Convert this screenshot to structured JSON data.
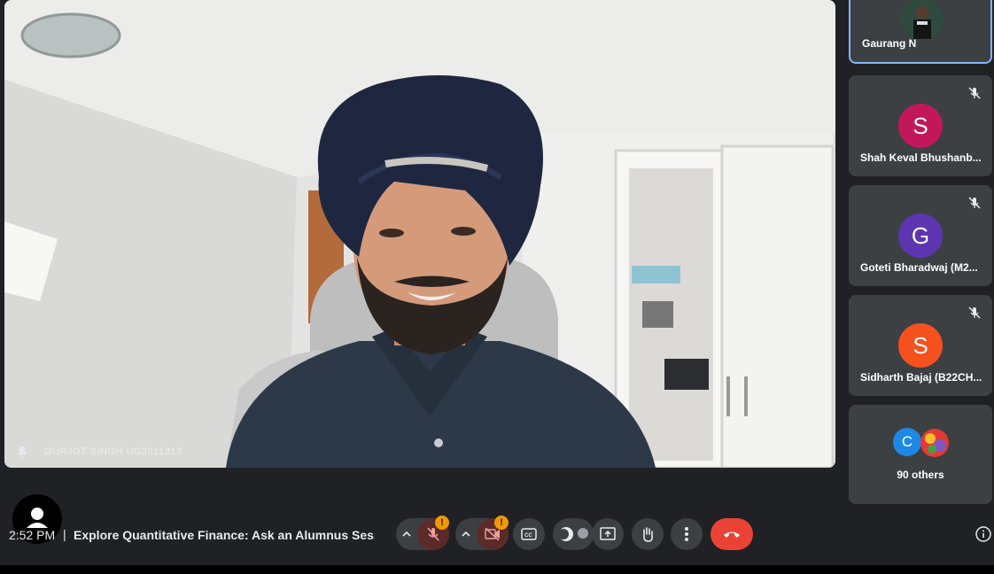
{
  "main_speaker": {
    "name": "GURJOT SINGH UG2011313"
  },
  "participants": [
    {
      "name": "Gaurang N",
      "type": "video",
      "active": true
    },
    {
      "name": "Shah Keval Bhushanb...",
      "initial": "S",
      "color": "#c2185b",
      "muted": true
    },
    {
      "name": "Goteti Bharadwaj (M2...",
      "initial": "G",
      "color": "#5e35b1",
      "muted": true
    },
    {
      "name": "Sidharth Bajaj (B22CH...",
      "initial": "S",
      "color": "#f4511e",
      "muted": true
    }
  ],
  "others": {
    "label": "90 others",
    "initial": "C",
    "color": "#1e88e5"
  },
  "meeting": {
    "time": "2:52 PM",
    "separator": "|",
    "title": "Explore Quantitative Finance: Ask an Alumnus Sess..."
  },
  "controls": {
    "mic_badge": "!",
    "cam_badge": "!",
    "icons": [
      "chevron-up-icon",
      "mic-off-icon",
      "chevron-up-icon",
      "camera-off-icon",
      "captions-icon",
      "effects-icon",
      "present-icon",
      "raise-hand-icon",
      "more-options-icon",
      "end-call-icon",
      "info-icon"
    ]
  },
  "colors": {
    "background": "#202124",
    "tile": "#3c4043",
    "accent": "#8ab4f8",
    "end_call": "#ea4335",
    "warning": "#f29900"
  }
}
